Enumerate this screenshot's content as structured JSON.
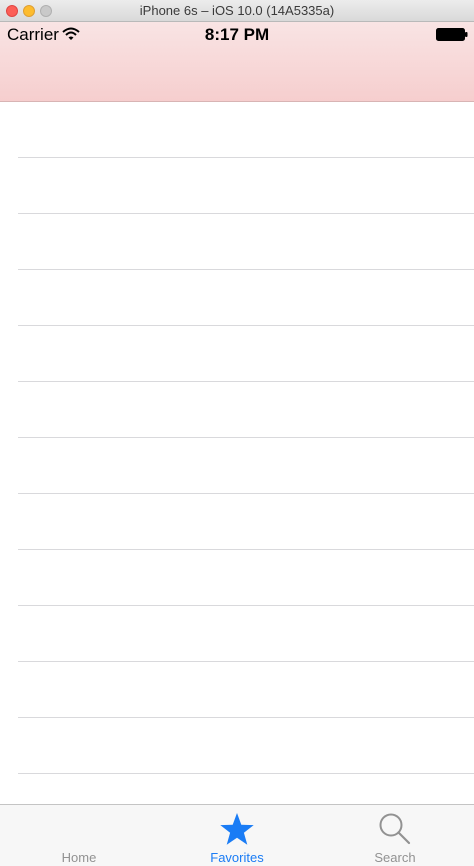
{
  "window": {
    "title": "iPhone 6s – iOS 10.0 (14A5335a)"
  },
  "status_bar": {
    "carrier": "Carrier",
    "time": "8:17 PM"
  },
  "table": {
    "row_count": 13
  },
  "tab_bar": {
    "items": [
      {
        "label": "Home",
        "icon": "home-icon",
        "selected": false
      },
      {
        "label": "Favorites",
        "icon": "star-icon",
        "selected": true
      },
      {
        "label": "Search",
        "icon": "search-icon",
        "selected": false
      }
    ]
  },
  "colors": {
    "navbar_tint": "#f6cece",
    "tab_active": "#1a7cf5",
    "tab_inactive": "#929292"
  }
}
